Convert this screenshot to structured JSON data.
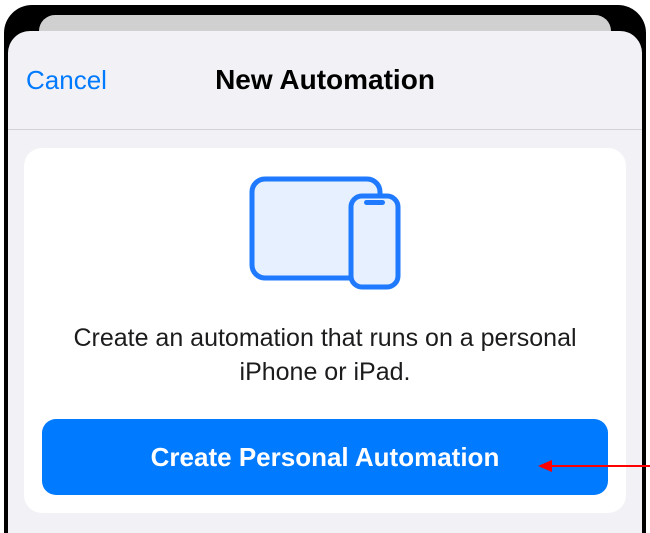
{
  "nav": {
    "cancel_label": "Cancel",
    "title": "New Automation"
  },
  "card": {
    "description": "Create an automation that runs on a personal iPhone or iPad.",
    "primary_button_label": "Create Personal Automation"
  },
  "colors": {
    "accent": "#007aff",
    "sheet_bg": "#f2f2f6",
    "card_bg": "#ffffff"
  },
  "icon": {
    "name": "devices-ipad-iphone"
  }
}
